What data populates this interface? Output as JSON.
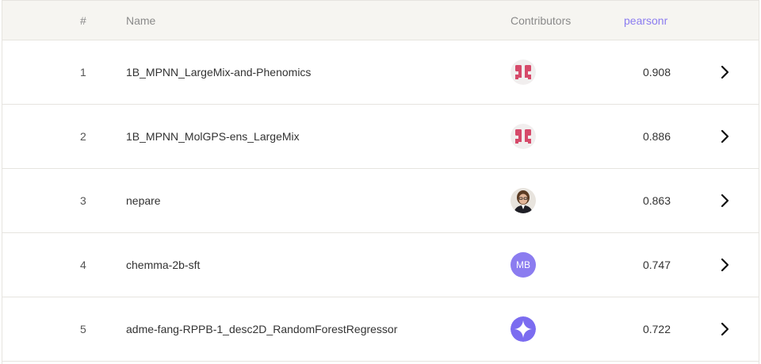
{
  "header": {
    "rank": "#",
    "name": "Name",
    "contributors": "Contributors",
    "metric": "pearsonr"
  },
  "rows": [
    {
      "rank": "1",
      "name": "1B_MPNN_LargeMix-and-Phenomics",
      "contributor_avatar": "valence-logo-icon",
      "score": "0.908"
    },
    {
      "rank": "2",
      "name": "1B_MPNN_MolGPS-ens_LargeMix",
      "contributor_avatar": "valence-logo-icon",
      "score": "0.886"
    },
    {
      "rank": "3",
      "name": "nepare",
      "contributor_avatar": "user-photo-avatar",
      "score": "0.863"
    },
    {
      "rank": "4",
      "name": "chemma-2b-sft",
      "contributor_avatar": "initials-avatar",
      "initials": "MB",
      "score": "0.747"
    },
    {
      "rank": "5",
      "name": "adme-fang-RPPB-1_desc2D_RandomForestRegressor",
      "contributor_avatar": "sparkle-logo-icon",
      "score": "0.722"
    }
  ],
  "colors": {
    "accent": "#8b7cf0",
    "header_bg": "#f6f5f1",
    "valence_logo": "#d64a6a"
  }
}
